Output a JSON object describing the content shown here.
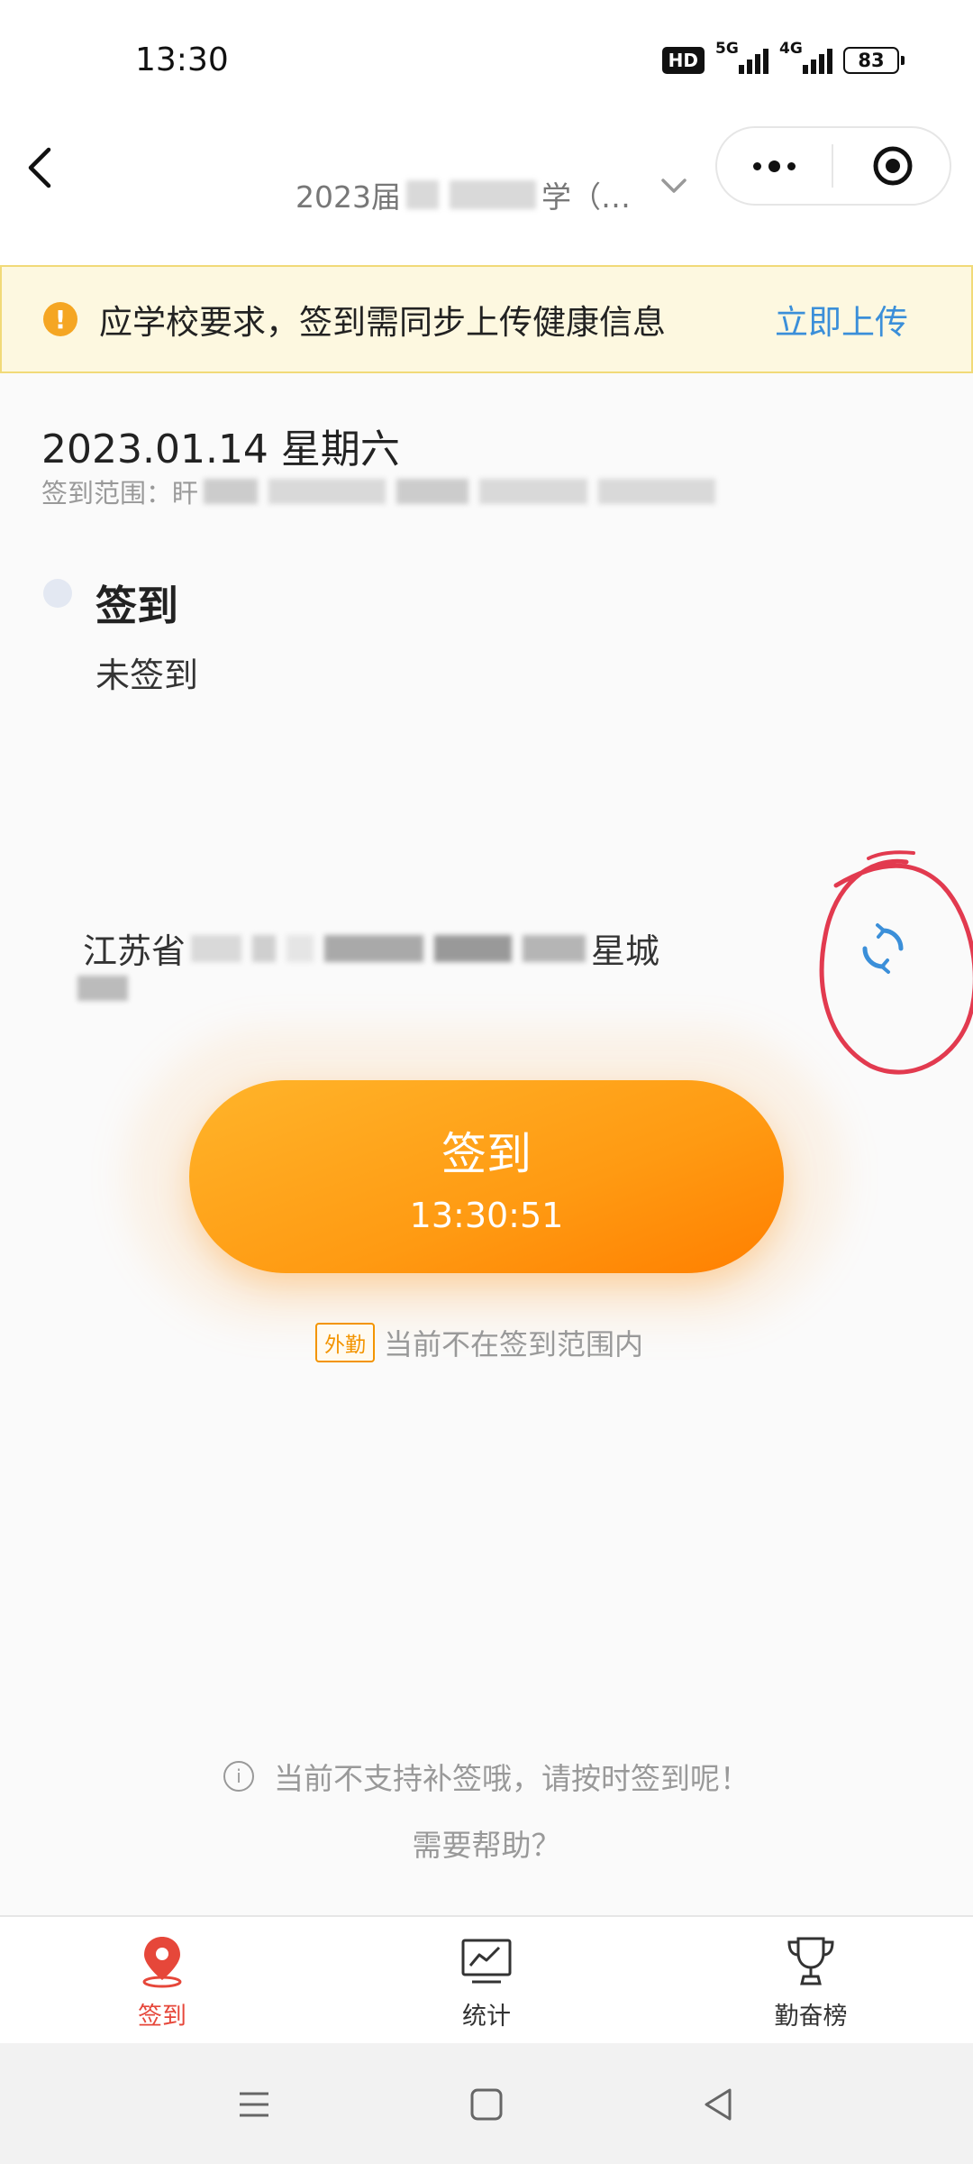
{
  "status_bar": {
    "time": "13:30",
    "hd_label": "HD",
    "signal_1_label": "5G",
    "signal_2_label": "4G",
    "battery": "83"
  },
  "nav": {
    "title_prefix": "2023届",
    "title_suffix": "学（…",
    "back_icon": "chevron-left-icon",
    "dropdown_icon": "chevron-down-icon",
    "more_icon": "more-dots-icon",
    "close_icon": "target-close-icon"
  },
  "notice": {
    "icon": "exclamation-icon",
    "text": "应学校要求，签到需同步上传健康信息",
    "link": "立即上传",
    "accent": "#f5a623",
    "link_color": "#3b8fd9"
  },
  "date": "2023.01.14 星期六",
  "range_label": "签到范围：盰",
  "checkin": {
    "title": "签到",
    "status": "未签到"
  },
  "location": {
    "prefix": "江苏省",
    "suffix": "星城",
    "refresh_icon": "refresh-icon"
  },
  "main_button": {
    "label": "签到",
    "time": "13:30:51",
    "color": "#ff9a12"
  },
  "out_of_range": {
    "badge": "外勤",
    "text": "当前不在签到范围内"
  },
  "info": {
    "text": "当前不支持补签哦，请按时签到呢！",
    "help": "需要帮助？"
  },
  "tabs": [
    {
      "label": "签到",
      "icon": "location-pin-icon",
      "active": true
    },
    {
      "label": "统计",
      "icon": "chart-icon",
      "active": false
    },
    {
      "label": "勤奋榜",
      "icon": "trophy-icon",
      "active": false
    }
  ],
  "system_nav": {
    "menu_icon": "menu-icon",
    "home_icon": "home-square-icon",
    "back_icon": "back-triangle-icon"
  }
}
